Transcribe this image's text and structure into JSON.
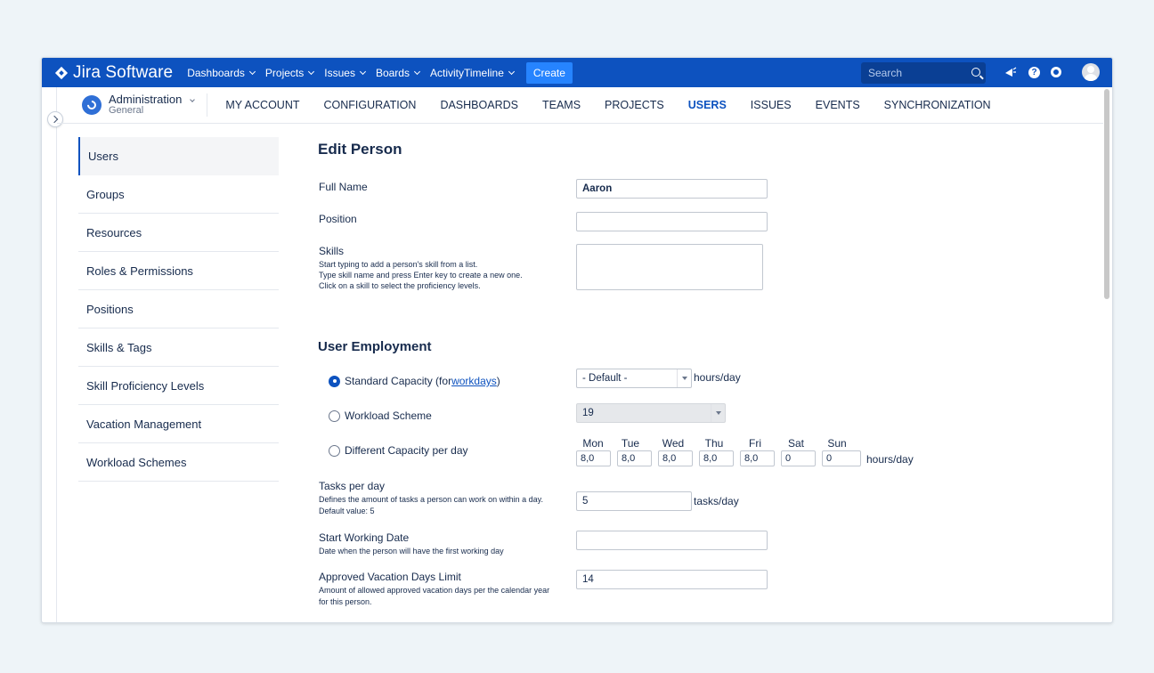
{
  "topbar": {
    "brand": "Jira Software",
    "nav": [
      {
        "label": "Dashboards"
      },
      {
        "label": "Projects"
      },
      {
        "label": "Issues"
      },
      {
        "label": "Boards"
      },
      {
        "label": "ActivityTimeline"
      }
    ],
    "create_label": "Create",
    "search_placeholder": "Search",
    "accent": "#0d52bf"
  },
  "admin": {
    "title": "Administration",
    "subtitle": "General",
    "nav": [
      {
        "label": "MY ACCOUNT"
      },
      {
        "label": "CONFIGURATION"
      },
      {
        "label": "DASHBOARDS"
      },
      {
        "label": "TEAMS"
      },
      {
        "label": "PROJECTS"
      },
      {
        "label": "USERS"
      },
      {
        "label": "ISSUES"
      },
      {
        "label": "EVENTS"
      },
      {
        "label": "SYNCHRONIZATION"
      }
    ],
    "active_nav": "USERS"
  },
  "sidebar": {
    "items": [
      {
        "label": "Users"
      },
      {
        "label": "Groups"
      },
      {
        "label": "Resources"
      },
      {
        "label": "Roles & Permissions"
      },
      {
        "label": "Positions"
      },
      {
        "label": "Skills & Tags"
      },
      {
        "label": "Skill Proficiency Levels"
      },
      {
        "label": "Vacation Management"
      },
      {
        "label": "Workload Schemes"
      }
    ],
    "active": "Users"
  },
  "form": {
    "title": "Edit Person",
    "full_name": {
      "label": "Full Name",
      "value": "Aaron"
    },
    "position": {
      "label": "Position",
      "value": ""
    },
    "skills": {
      "label": "Skills",
      "hint1": "Start typing to add a person's skill from a list.",
      "hint2": "Type skill name and press Enter key to create a new one.",
      "hint3": "Click on a skill to select the proficiency levels."
    },
    "employment": {
      "title": "User Employment",
      "standard_label": "Standard Capacity (for ",
      "standard_link": "workdays",
      "standard_suffix": ")",
      "standard_select": "- Default -",
      "hours_unit": "hours/day",
      "workload_label": "Workload Scheme",
      "workload_select": "19",
      "different_label": "Different Capacity per day",
      "selected": "standard",
      "days": [
        {
          "name": "Mon",
          "value": "8,0"
        },
        {
          "name": "Tue",
          "value": "8,0"
        },
        {
          "name": "Wed",
          "value": "8,0"
        },
        {
          "name": "Thu",
          "value": "8,0"
        },
        {
          "name": "Fri",
          "value": "8,0"
        },
        {
          "name": "Sat",
          "value": "0"
        },
        {
          "name": "Sun",
          "value": "0"
        }
      ],
      "days_unit": "hours/day"
    },
    "tasks": {
      "label": "Tasks per day",
      "hint1": "Defines the amount of tasks a person can work on within a day.",
      "hint2": "Default value: 5",
      "value": "5",
      "unit": "tasks/day"
    },
    "start_date": {
      "label": "Start Working Date",
      "hint": "Date when the person will have the first working day",
      "value": ""
    },
    "vacation": {
      "label": "Approved Vacation Days Limit",
      "hint1": "Amount of allowed approved vacation days per the calendar year",
      "hint2": "for this person.",
      "value": "14"
    }
  }
}
